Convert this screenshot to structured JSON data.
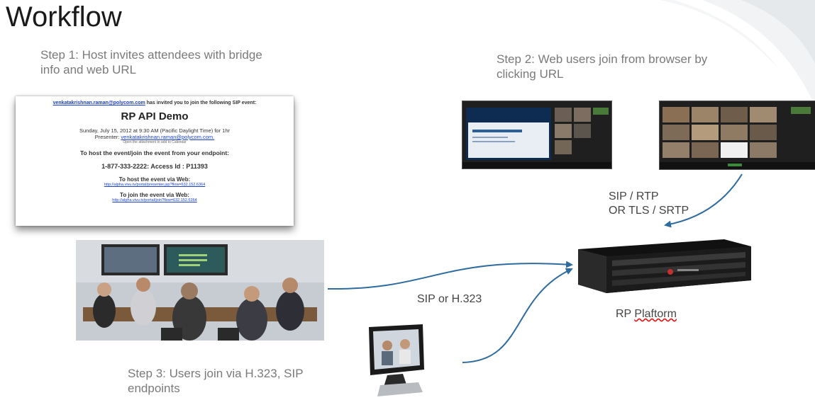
{
  "title": "Workflow",
  "step1": "Step 1: Host invites attendees with bridge info and web URL",
  "step2": "Step 2: Web users join from browser by clicking URL",
  "step3": "Step 3: Users join via H.323, SIP endpoints",
  "invite": {
    "sender": "venkatakrishnan.raman@polycom.com",
    "header_rest": " has invited you to join the following SIP event:",
    "event_name": "RP API Demo",
    "when": "Sunday, July 15, 2012 at 9:30 AM (Pacific Daylight Time) for 1hr",
    "presenter_label": "Presenter: ",
    "presenter_email": "venkatakrishnan.raman@polycom.com.",
    "calendar_note": "Open the attachment to add to Calendar",
    "host_join_line": "To host the event/join the event from your endpoint:",
    "access_line": "1-877-333-2222: Access Id : P11393",
    "host_web_heading": "To host the event via Web:",
    "host_web_url": "http://alpha.vivu.tv/portal/presenter.jsp?flow=632.152.6364",
    "join_web_heading": "To join the event via Web:",
    "join_web_url": "http://alpha.vivu.tv/portal/join?flow=632.152.6364"
  },
  "labels": {
    "sip_rtp_line1": "SIP / RTP",
    "sip_rtp_line2": "OR TLS / SRTP",
    "sip_or_h323": "SIP or H.323",
    "rp_platform_prefix": "RP ",
    "rp_platform_misspelled": "Plaftorm"
  },
  "colors": {
    "arrow": "#2e6b9e",
    "link": "#1a3fd0"
  },
  "icons": {
    "web_client_1": "web-conference-presentation-screen",
    "web_client_2": "web-conference-gallery-screen",
    "room_system": "telepresence-room-photo",
    "desktop_endpoint": "desktop-video-phone",
    "rp_platform": "rack-server-appliance"
  }
}
